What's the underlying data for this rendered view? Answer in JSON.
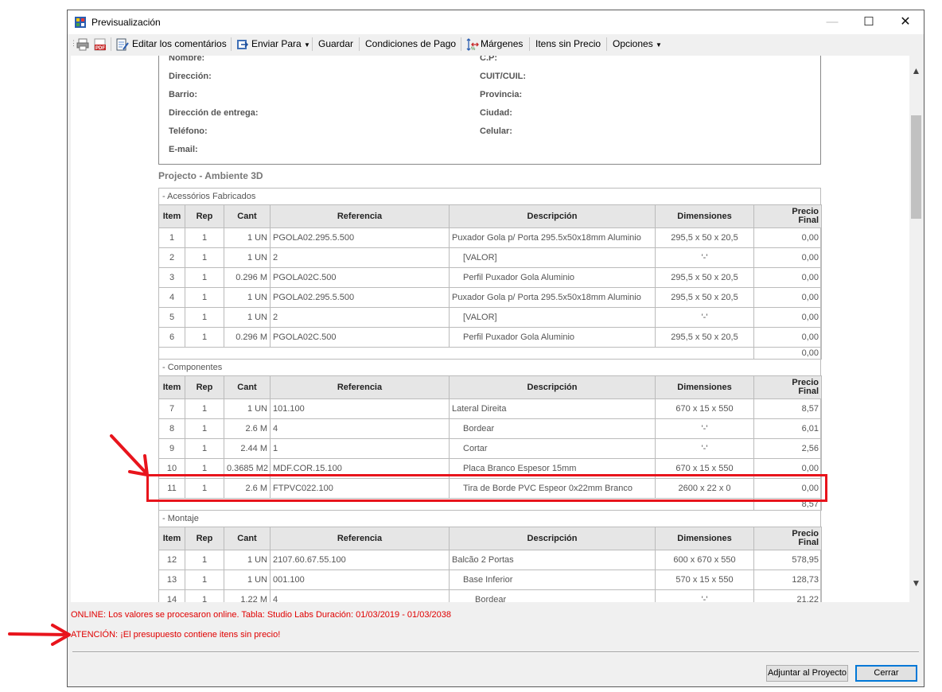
{
  "window": {
    "title": "Previsualización",
    "controls": {
      "minimize": "—",
      "maximize": "☐",
      "close": "✕"
    }
  },
  "toolbar": {
    "print_icon": "printer-icon",
    "pdf_icon": "pdf-icon",
    "edit_comments": "Editar los comentários",
    "send_to": "Enviar Para",
    "save": "Guardar",
    "payment_terms": "Condiciones de Pago",
    "margins": "Márgenes",
    "items_no_price": "Itens sin Precio",
    "options": "Opciones"
  },
  "client": {
    "name": "Nombre:",
    "cp": "C.P:",
    "address": "Dirección:",
    "cuit": "CUIT/CUIL:",
    "neighborhood": "Barrio:",
    "province": "Provincia:",
    "delivery": "Dirección de entrega:",
    "city": "Ciudad:",
    "phone": "Teléfono:",
    "mobile": "Celular:",
    "email": "E-mail:"
  },
  "project_title": "Projecto - Ambiente 3D",
  "columns": {
    "item": "Item",
    "rep": "Rep",
    "cant": "Cant",
    "ref": "Referencia",
    "desc": "Descripción",
    "dim": "Dimensiones",
    "price1": "Precio",
    "price2": "Final"
  },
  "groups": [
    {
      "title": "- Acessórios Fabricados",
      "subtotal": "0,00",
      "rows": [
        {
          "item": "1",
          "rep": "1",
          "cant": "1 UN",
          "ref": "PGOLA02.295.5.500",
          "desc": "Puxador Gola p/ Porta 295.5x50x18mm Aluminio",
          "dim": "295,5 x 50 x 20,5",
          "price": "0,00"
        },
        {
          "item": "2",
          "rep": "1",
          "cant": "1 UN",
          "ref": "2",
          "desc": "[VALOR]",
          "dim": "'-'",
          "price": "0,00"
        },
        {
          "item": "3",
          "rep": "1",
          "cant": "0.296 M",
          "ref": "PGOLA02C.500",
          "desc": "Perfil Puxador Gola Aluminio",
          "dim": "295,5 x 50 x 20,5",
          "price": "0,00"
        },
        {
          "item": "4",
          "rep": "1",
          "cant": "1 UN",
          "ref": "PGOLA02.295.5.500",
          "desc": "Puxador Gola p/ Porta 295.5x50x18mm Aluminio",
          "dim": "295,5 x 50 x 20,5",
          "price": "0,00"
        },
        {
          "item": "5",
          "rep": "1",
          "cant": "1 UN",
          "ref": "2",
          "desc": "[VALOR]",
          "dim": "'-'",
          "price": "0,00"
        },
        {
          "item": "6",
          "rep": "1",
          "cant": "0.296 M",
          "ref": "PGOLA02C.500",
          "desc": "Perfil Puxador Gola Aluminio",
          "dim": "295,5 x 50 x 20,5",
          "price": "0,00"
        }
      ]
    },
    {
      "title": "- Componentes",
      "subtotal": "8,57",
      "rows": [
        {
          "item": "7",
          "rep": "1",
          "cant": "1 UN",
          "ref": "101.100",
          "desc": "Lateral Direita",
          "dim": "670 x 15 x 550",
          "price": "8,57"
        },
        {
          "item": "8",
          "rep": "1",
          "cant": "2.6 M",
          "ref": "4",
          "desc": "Bordear",
          "dim": "'-'",
          "price": "6,01"
        },
        {
          "item": "9",
          "rep": "1",
          "cant": "2.44 M",
          "ref": "1",
          "desc": "Cortar",
          "dim": "'-'",
          "price": "2,56"
        },
        {
          "item": "10",
          "rep": "1",
          "cant": "0.3685 M2",
          "ref": "MDF.COR.15.100",
          "desc": "Placa Branco Espesor 15mm",
          "dim": "670 x 15 x 550",
          "price": "0,00"
        },
        {
          "item": "11",
          "rep": "1",
          "cant": "2.6 M",
          "ref": "FTPVC022.100",
          "desc": "Tira de Borde PVC Espeor 0x22mm Branco",
          "dim": "2600 x 22 x 0",
          "price": "0,00"
        }
      ]
    },
    {
      "title": "- Montaje",
      "rows": [
        {
          "item": "12",
          "rep": "1",
          "cant": "1 UN",
          "ref": "2107.60.67.55.100",
          "desc": "Balcão 2 Portas",
          "dim": "600 x 670 x 550",
          "price": "578,95"
        },
        {
          "item": "13",
          "rep": "1",
          "cant": "1 UN",
          "ref": "001.100",
          "desc": "Base Inferior",
          "dim": "570 x 15 x 550",
          "price": "128,73"
        },
        {
          "item": "14",
          "rep": "1",
          "cant": "1.22 M",
          "ref": "4",
          "desc": "Bordear",
          "dim": "'-'",
          "price": "21,22"
        }
      ]
    }
  ],
  "status": {
    "online": "ONLINE: Los valores se procesaron online. Tabla: Studio Labs Duración: 01/03/2019 - 01/03/2038",
    "warning": "ATENCIÓN: ¡El presupuesto contiene itens sin precio!"
  },
  "buttons": {
    "adjust": "Adjuntar al Proyecto",
    "close": "Cerrar"
  },
  "annotation_color": "#e8141c"
}
